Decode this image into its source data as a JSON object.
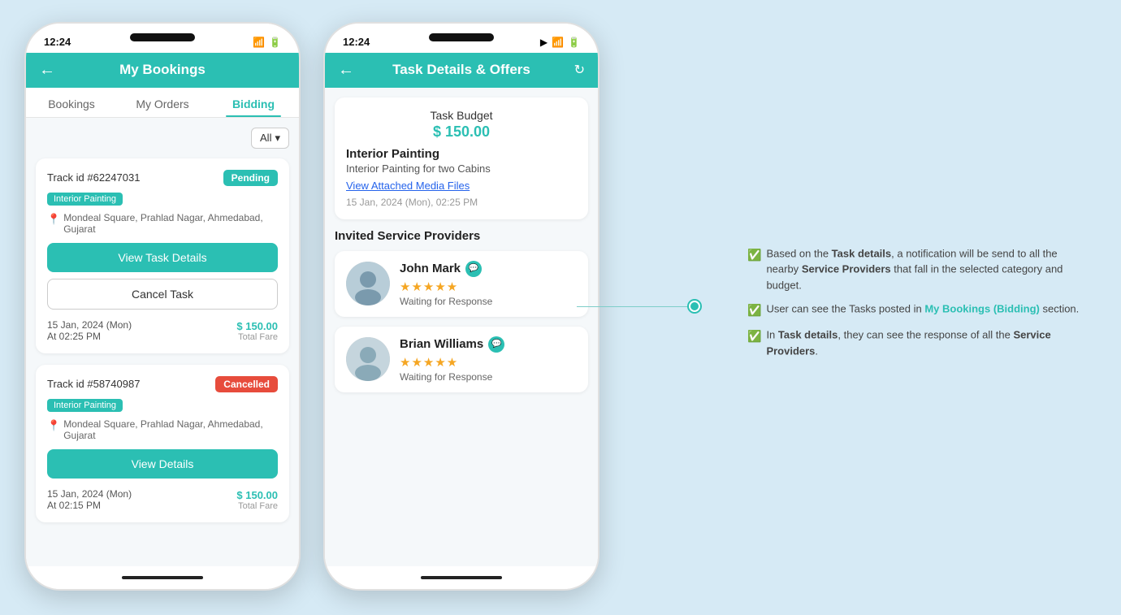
{
  "phone1": {
    "status_bar": {
      "time": "12:24",
      "icons": "wifi battery"
    },
    "header": {
      "title": "My Bookings",
      "back_icon": "←"
    },
    "tabs": [
      {
        "label": "Bookings",
        "active": false
      },
      {
        "label": "My Orders",
        "active": false
      },
      {
        "label": "Bidding",
        "active": true
      }
    ],
    "filter": {
      "label": "All",
      "icon": "▾"
    },
    "cards": [
      {
        "track_id": "Track id #62247031",
        "badge": "Pending",
        "badge_type": "pending",
        "category": "Interior Painting",
        "location": "Mondeal Square, Prahlad Nagar, Ahmedabad, Gujarat",
        "btn_primary": "View Task Details",
        "btn_outline": "Cancel Task",
        "date": "15 Jan, 2024 (Mon)",
        "time": "At 02:25 PM",
        "price": "$ 150.00",
        "price_label": "Total Fare"
      },
      {
        "track_id": "Track id #58740987",
        "badge": "Cancelled",
        "badge_type": "cancelled",
        "category": "Interior Painting",
        "location": "Mondeal Square, Prahlad Nagar, Ahmedabad, Gujarat",
        "btn_primary": "View Details",
        "btn_outline": null,
        "date": "15 Jan, 2024 (Mon)",
        "time": "At 02:15 PM",
        "price": "$ 150.00",
        "price_label": "Total Fare"
      }
    ]
  },
  "phone2": {
    "status_bar": {
      "time": "12:24",
      "icons": "wifi battery"
    },
    "header": {
      "title": "Task Details & Offers",
      "back_icon": "←",
      "refresh_icon": "↻"
    },
    "task": {
      "budget_label": "Task Budget",
      "budget_amount": "$ 150.00",
      "name": "Interior Painting",
      "description": "Interior Painting for two Cabins",
      "media_link": "View Attached Media Files",
      "date": "15 Jan, 2024 (Mon),  02:25 PM"
    },
    "invited_section": {
      "title": "Invited Service Providers"
    },
    "providers": [
      {
        "name": "John Mark",
        "rating": 5,
        "status": "Waiting for Response",
        "avatar_emoji": "👨"
      },
      {
        "name": "Brian Williams",
        "rating": 5,
        "status": "Waiting for Response",
        "avatar_emoji": "👨‍💼"
      }
    ]
  },
  "annotation": {
    "items": [
      {
        "text": "Based on the Task details, a notification will be send to all the nearby Service Providers that fall in the selected category and budget.",
        "bold_parts": [
          "Task details",
          "Service Providers"
        ]
      },
      {
        "text": "User can see the Tasks posted in My Bookings (Bidding) section.",
        "highlight_teal": [
          "My Bookings (Bidding)"
        ],
        "bold_parts": [
          "Tasks posted"
        ]
      },
      {
        "text": "In Task details, they can see the response of all the Service Providers.",
        "bold_parts": [
          "Task details",
          "Service Providers"
        ]
      }
    ]
  }
}
